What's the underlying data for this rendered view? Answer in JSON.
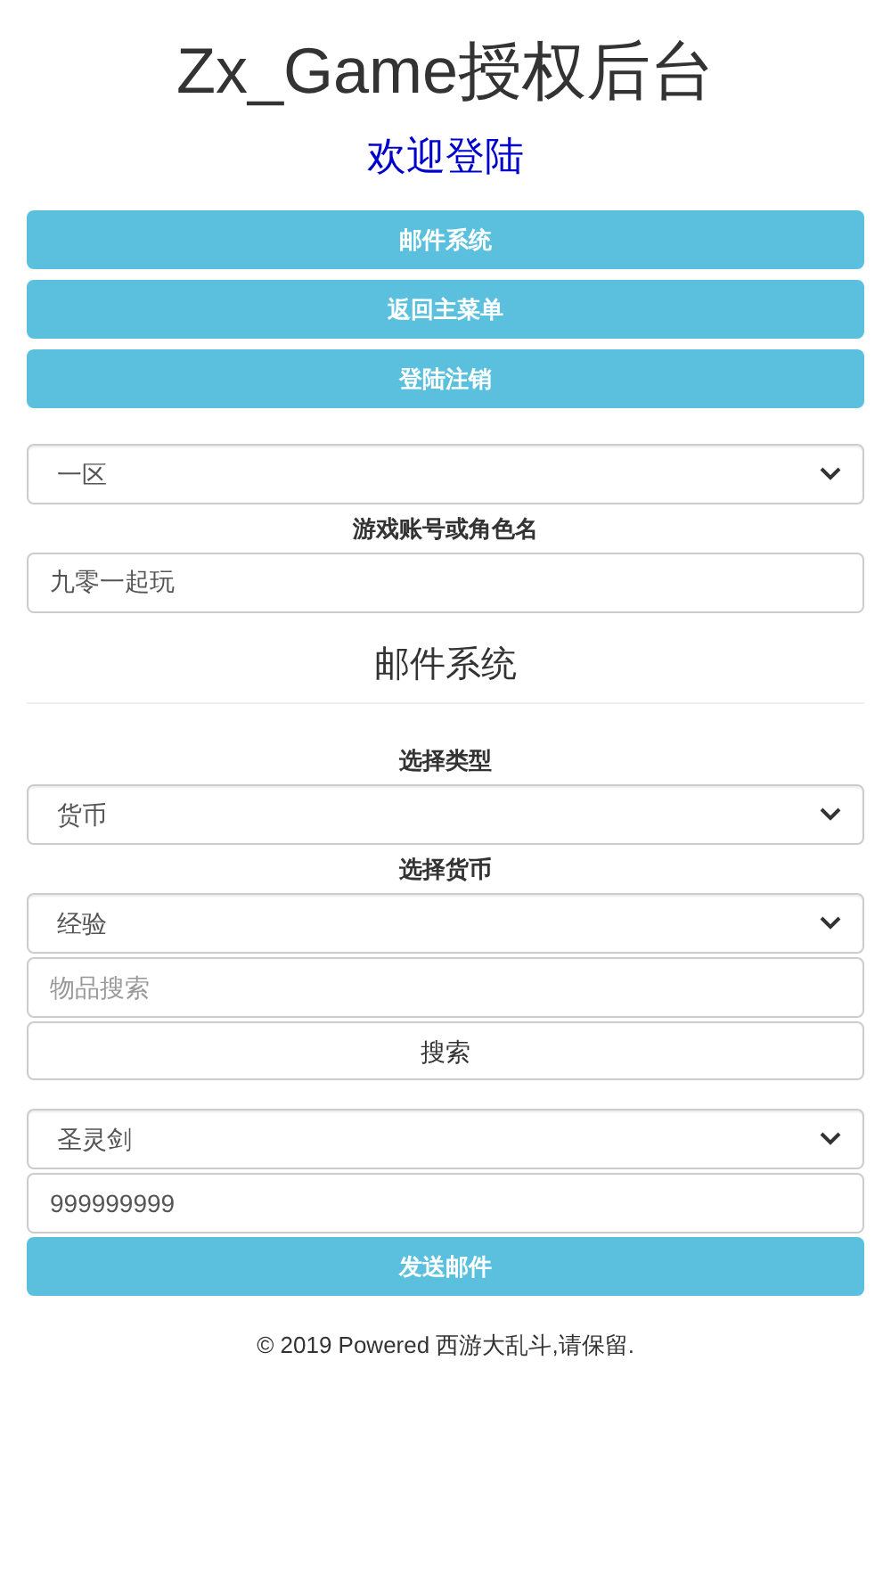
{
  "title": "Zx_Game授权后台",
  "subtitle": "欢迎登陆",
  "nav_buttons": [
    "邮件系统",
    "返回主菜单",
    "登陆注销"
  ],
  "account": {
    "server": "一区",
    "label": "游戏账号或角色名",
    "name": "九零一起玩"
  },
  "mail": {
    "heading": "邮件系统",
    "type_label": "选择类型",
    "type": "货币",
    "currency_label": "选择货币",
    "currency": "经验",
    "search": {
      "placeholder": "物品搜索"
    },
    "search_button": "搜索",
    "item": "圣灵剑",
    "amount": "999999999",
    "send_button": "发送邮件"
  },
  "footer": "© 2019 Powered 西游大乱斗,请保留."
}
